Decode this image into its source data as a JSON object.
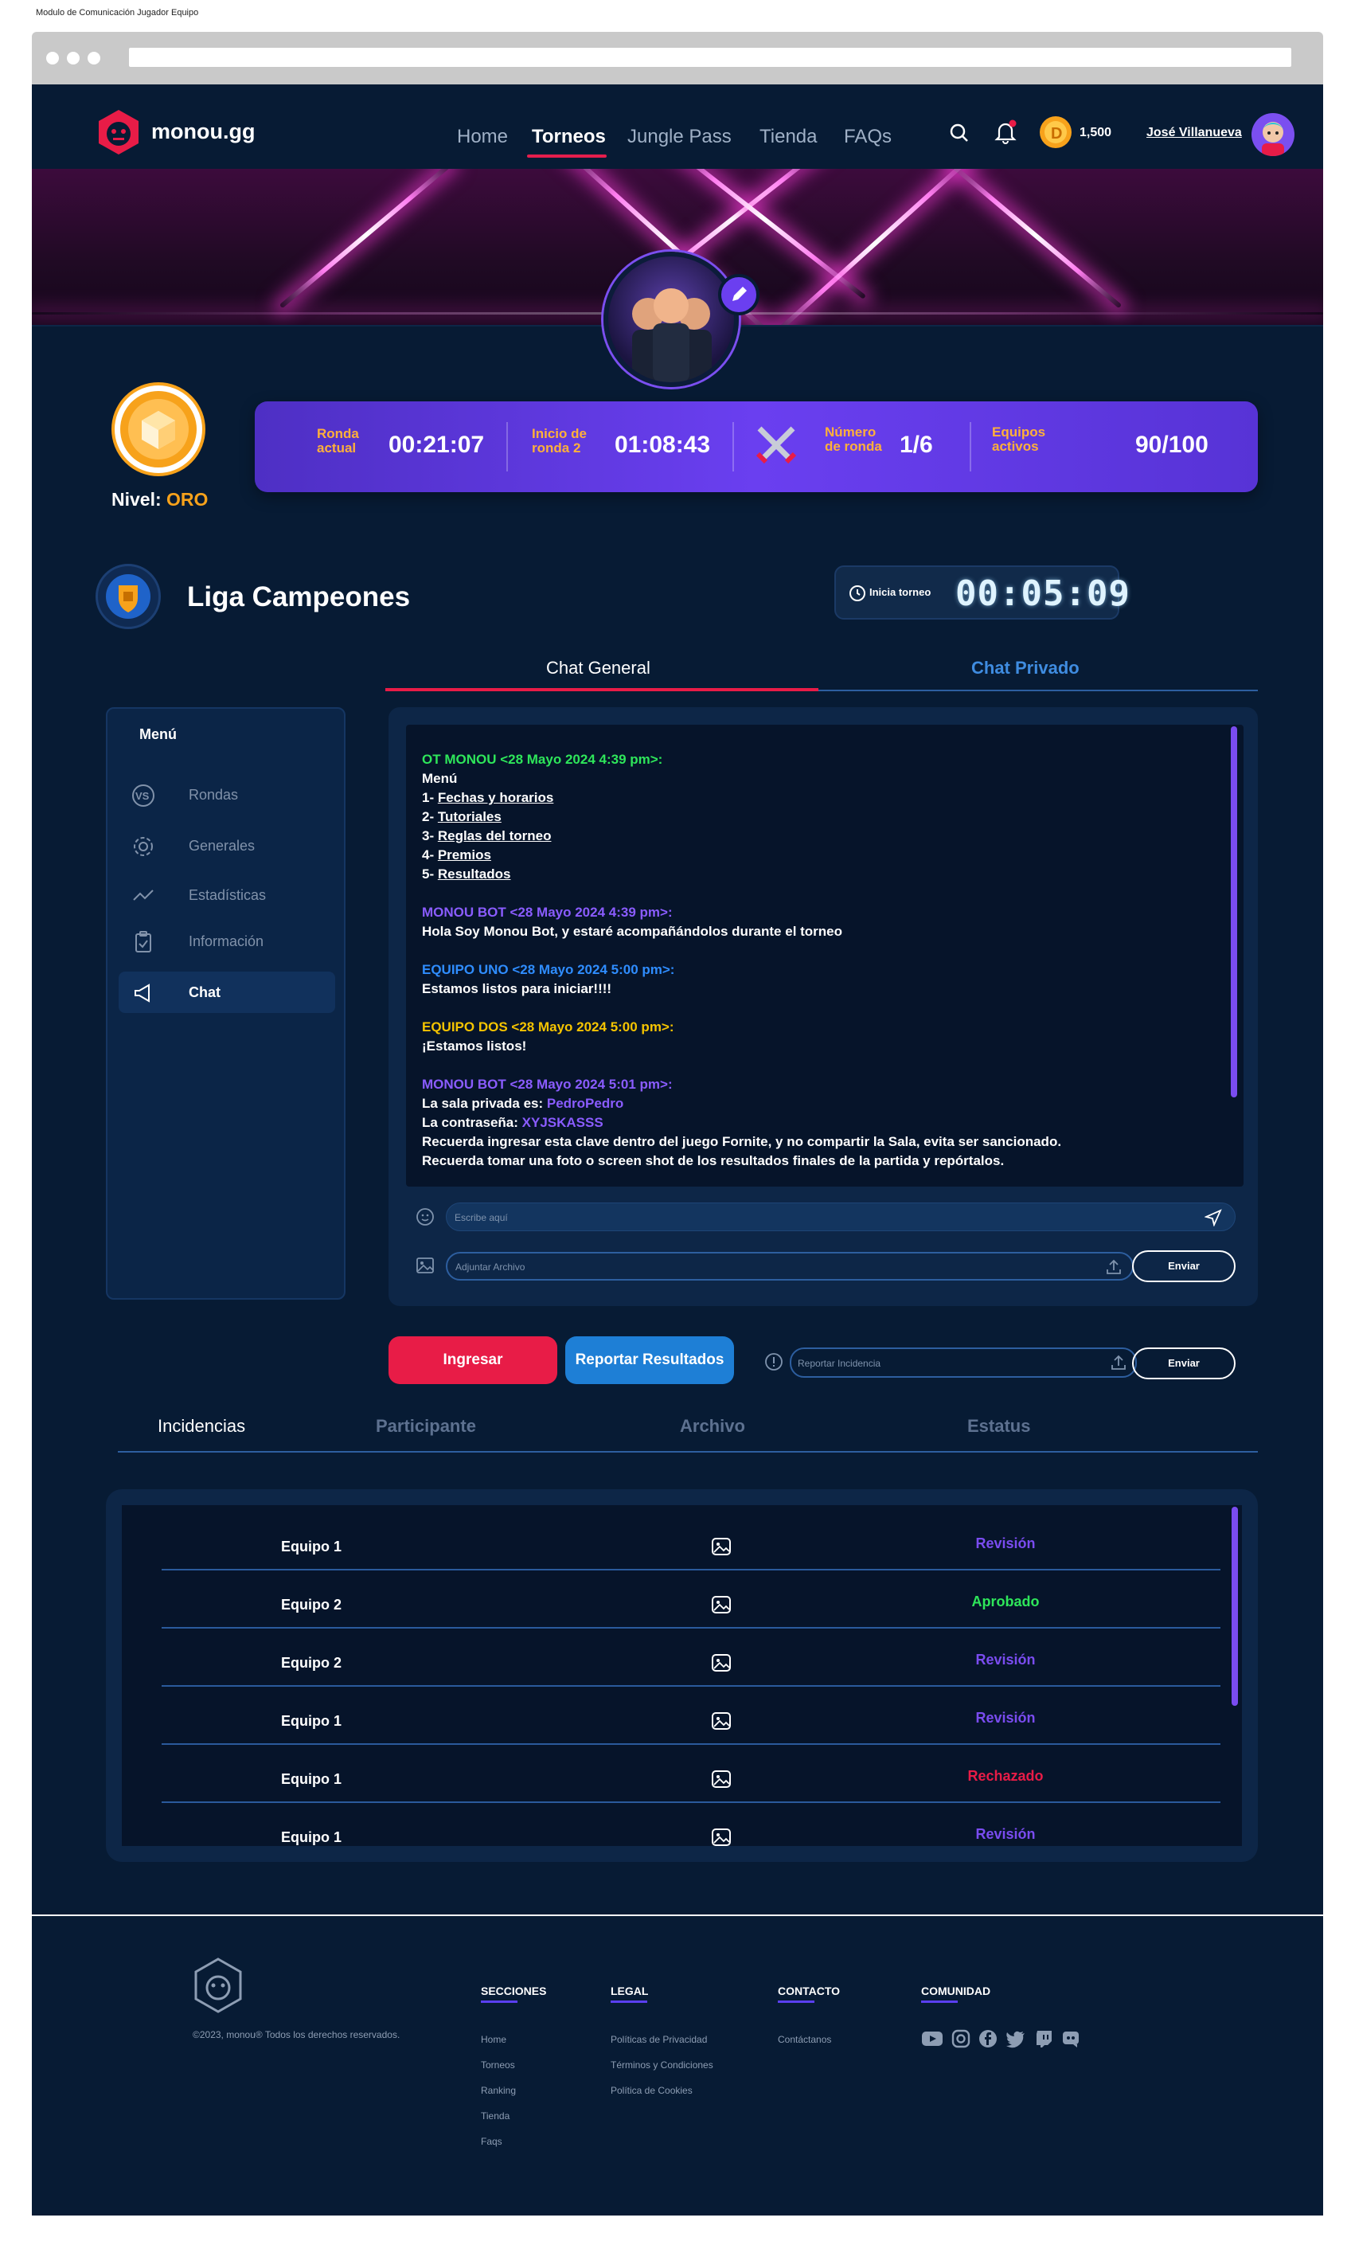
{
  "caption": "Modulo de Comunicación Jugador Equipo",
  "header": {
    "brand": "monou.gg",
    "nav": [
      "Home",
      "Torneos",
      "Jungle Pass",
      "Tienda",
      "FAQs"
    ],
    "active_nav": "Torneos",
    "coins": "1,500",
    "username": "José Villanueva"
  },
  "level": {
    "label": "Nivel:",
    "value": "ORO"
  },
  "stats": {
    "round_current_label_1": "Ronda",
    "round_current_label_2": "actual",
    "round_current_value": "00:21:07",
    "round2_start_label_1": "Inicio de",
    "round2_start_label_2": "ronda 2",
    "round2_start_value": "01:08:43",
    "round_number_label_1": "Número",
    "round_number_label_2": "de ronda",
    "round_number_value": "1/6",
    "active_teams_label_1": "Equipos",
    "active_teams_label_2": "activos",
    "active_teams_value": "90/100"
  },
  "league": {
    "title": "Liga Campeones"
  },
  "countdown": {
    "label": "Inicia torneo",
    "value": "00:05:09"
  },
  "tabs": {
    "general": "Chat General",
    "private": "Chat Privado"
  },
  "menu": {
    "title": "Menú",
    "items": [
      {
        "label": "Rondas",
        "icon": "vs-icon"
      },
      {
        "label": "Generales",
        "icon": "gear-icon"
      },
      {
        "label": "Estadísticas",
        "icon": "trend-icon"
      },
      {
        "label": "Información",
        "icon": "clipboard-icon"
      },
      {
        "label": "Chat",
        "icon": "megaphone-icon"
      }
    ],
    "active": "Chat"
  },
  "chat": {
    "messages": [
      {
        "author": "OT MONOU <28 Mayo 2024 4:39 pm>:",
        "color": "#2ee65a"
      },
      {
        "author": "MONOU BOT <28 Mayo 2024 4:39 pm>:",
        "color": "#8a5cff",
        "text": "Hola Soy Monou Bot, y estaré acompañándolos durante el torneo"
      },
      {
        "author": "EQUIPO UNO <28 Mayo 2024 5:00 pm>:",
        "color": "#2f8dff",
        "text": "Estamos listos para iniciar!!!!"
      },
      {
        "author": "EQUIPO DOS <28 Mayo 2024 5:00 pm>:",
        "color": "#f5c400",
        "text": "¡Estamos listos!"
      },
      {
        "author": "MONOU BOT <28 Mayo 2024 5:01 pm>:",
        "color": "#8a5cff"
      }
    ],
    "menu_title": "Menú",
    "menu_lines": [
      {
        "num": "1- ",
        "link": "Fechas y horarios"
      },
      {
        "num": "2- ",
        "link": "Tutoriales"
      },
      {
        "num": "3- ",
        "link": "Reglas del torneo"
      },
      {
        "num": "4- ",
        "link": "Premios"
      },
      {
        "num": "5- ",
        "link": "Resultados"
      }
    ],
    "room_label": "La sala privada es: ",
    "room_value": "PedroPedro",
    "password_label": "La contraseña:  ",
    "password_value": "XYJSKASSS",
    "note_1": "Recuerda ingresar esta clave dentro del juego Fornite, y no compartir la Sala, evita ser sancionado.",
    "note_2": "Recuerda tomar una foto o screen shot de los resultados finales de la partida y repórtalos.",
    "input_placeholder": "Escribe aquí",
    "attach_placeholder": "Adjuntar Archivo",
    "send_label": "Enviar"
  },
  "actions": {
    "join": "Ingresar",
    "report": "Reportar Resultados",
    "incident_placeholder": "Reportar Incidencia",
    "send": "Enviar"
  },
  "table": {
    "headers": [
      "Incidencias",
      "Participante",
      "Archivo",
      "Estatus"
    ],
    "rows": [
      {
        "team": "Equipo 1",
        "status": "Revisión",
        "color": "#7a4cf0"
      },
      {
        "team": "Equipo 2",
        "status": "Aprobado",
        "color": "#2ee65a"
      },
      {
        "team": "Equipo 2",
        "status": "Revisión",
        "color": "#7a4cf0"
      },
      {
        "team": "Equipo 1",
        "status": "Revisión",
        "color": "#7a4cf0"
      },
      {
        "team": "Equipo 1",
        "status": "Rechazado",
        "color": "#e81c47"
      },
      {
        "team": "Equipo 1",
        "status": "Revisión",
        "color": "#7a4cf0"
      }
    ]
  },
  "footer": {
    "copyright": "©2023, monou® Todos los derechos reservados.",
    "sections": {
      "title": "SECCIONES",
      "links": [
        "Home",
        "Torneos",
        "Ranking",
        "Tienda",
        "Faqs"
      ]
    },
    "legal": {
      "title": "LEGAL",
      "links": [
        "Políticas de Privacidad",
        "Términos y Condiciones",
        "Política de Cookies"
      ]
    },
    "contact": {
      "title": "CONTACTO",
      "links": [
        "Contáctanos"
      ]
    },
    "community": {
      "title": "COMUNIDAD",
      "icons": [
        "youtube-icon",
        "instagram-icon",
        "facebook-icon",
        "twitter-icon",
        "twitch-icon",
        "discord-icon"
      ]
    }
  },
  "colors": {
    "accent_red": "#e81c47",
    "accent_purple": "#6a3ff0",
    "background": "#071b34",
    "gold": "#f7a21b"
  }
}
